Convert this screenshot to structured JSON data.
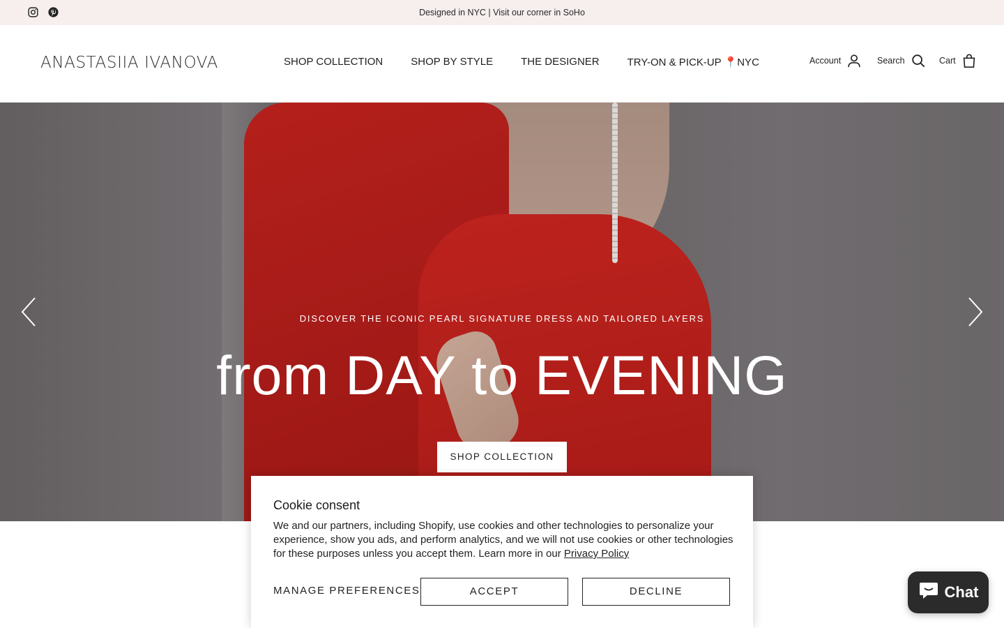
{
  "announcement": {
    "message": "Designed in NYC | Visit our corner in SoHo",
    "social": [
      "instagram-icon",
      "pinterest-icon"
    ]
  },
  "header": {
    "logo": "ANASTASIIA IVANOVA",
    "nav": [
      {
        "label": "SHOP COLLECTION"
      },
      {
        "label": "SHOP BY STYLE"
      },
      {
        "label": "THE DESIGNER"
      },
      {
        "label": "TRY-ON & PICK-UP 📍NYC"
      }
    ],
    "account_label": "Account",
    "search_label": "Search",
    "cart_label": "Cart"
  },
  "hero": {
    "kicker": "DISCOVER THE ICONIC PEARL SIGNATURE DRESS AND TAILORED LAYERS",
    "headline": "from DAY to EVENING",
    "cta": "SHOP COLLECTION"
  },
  "cookie": {
    "title": "Cookie consent",
    "body": "We and our partners, including Shopify, use cookies and other technologies to personalize your experience, show you ads, and perform analytics, and we will not use cookies or other technologies for these purposes unless you accept them. Learn more in our",
    "privacy_link": "Privacy Policy",
    "manage": "MANAGE PREFERENCES",
    "accept": "ACCEPT",
    "decline": "DECLINE"
  },
  "chat": {
    "label": "Chat"
  },
  "colors": {
    "announcement_bg": "#f7eeee",
    "chat_bg": "#2b2b2b",
    "dress_red": "#c8201c"
  }
}
